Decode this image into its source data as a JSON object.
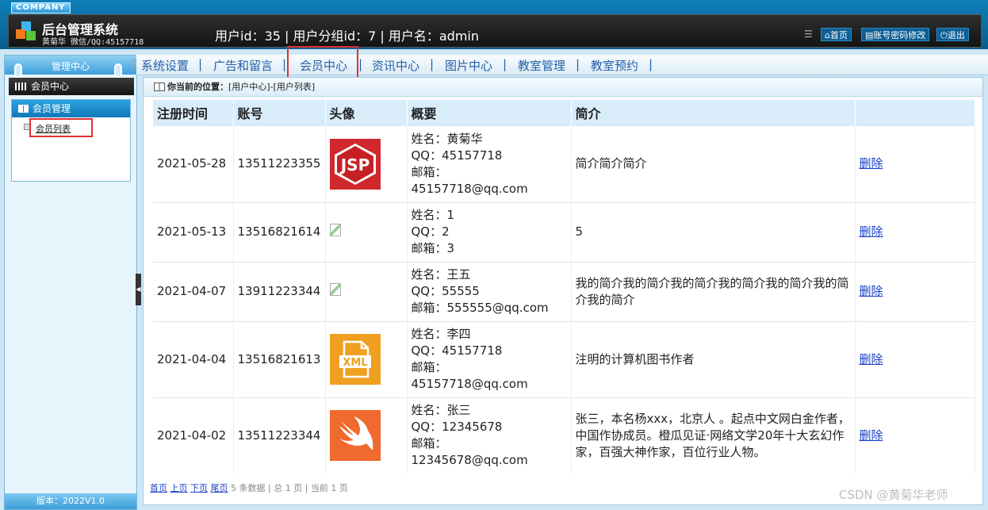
{
  "header": {
    "company": "COMPANY",
    "title": "后台管理系统",
    "subtitle": "黄菊华 微信/QQ:45157718",
    "userinfo": "用户id：35 | 用户分组id：7 | 用户名：admin",
    "home_label": "首页",
    "pwd_label": "账号密码修改",
    "logout_label": "退出"
  },
  "sidebar": {
    "top_label": "管理中心",
    "center_label": "会员中心",
    "group_label": "会员管理",
    "item_label": "会员列表",
    "version": "版本：2022V1.0"
  },
  "nav": {
    "items": [
      "系统设置",
      "广告和留言",
      "会员中心",
      "资讯中心",
      "图片中心",
      "教室管理",
      "教室预约"
    ],
    "separator": "|"
  },
  "breadcrumb": {
    "prefix": "你当前的位置：",
    "path": "[用户中心]-[用户列表]"
  },
  "table": {
    "headers": [
      "注册时间",
      "账号",
      "头像",
      "概要",
      "简介",
      ""
    ],
    "rows": [
      {
        "date": "2021-05-28",
        "account": "13511223355",
        "avatar": "jsp",
        "s1": "姓名：黄菊华",
        "s2": "QQ：45157718",
        "s3": "邮箱：",
        "s4": "45157718@qq.com",
        "intro": "简介简介简介",
        "action": "删除"
      },
      {
        "date": "2021-05-13",
        "account": "13516821614",
        "avatar": "broken",
        "s1": "姓名：1",
        "s2": "QQ：2",
        "s3": "邮箱：3",
        "s4": "",
        "intro": "5",
        "action": "删除"
      },
      {
        "date": "2021-04-07",
        "account": "13911223344",
        "avatar": "broken",
        "s1": "姓名：王五",
        "s2": "QQ：55555",
        "s3": "邮箱：555555@qq.com",
        "s4": "",
        "intro": "我的简介我的简介我的简介我的简介我的简介我的简介我的简介",
        "action": "删除"
      },
      {
        "date": "2021-04-04",
        "account": "13516821613",
        "avatar": "xml",
        "s1": "姓名：李四",
        "s2": "QQ：45157718",
        "s3": "邮箱：",
        "s4": "45157718@qq.com",
        "intro": "注明的计算机图书作者",
        "action": "删除"
      },
      {
        "date": "2021-04-02",
        "account": "13511223344",
        "avatar": "swift",
        "s1": "姓名：张三",
        "s2": "QQ：12345678",
        "s3": "邮箱：",
        "s4": "12345678@qq.com",
        "intro": "张三，本名杨xxx，北京人 。起点中文网白金作者，中国作协成员。橙瓜见证·网络文学20年十大玄幻作家，百强大神作家，百位行业人物。",
        "action": "删除"
      }
    ]
  },
  "pager": {
    "first": "首页",
    "prev": "上页",
    "next": "下页",
    "last": "尾页",
    "info": "5 条数据 | 总 1 页 | 当前 1 页"
  },
  "avatar_labels": {
    "jsp": "JSP",
    "xml": "XML"
  },
  "watermark": "CSDN @黄菊华老师",
  "colors": {
    "accent": "#0d7fb8",
    "link": "#1a3fc8",
    "highlight": "#e03030"
  }
}
